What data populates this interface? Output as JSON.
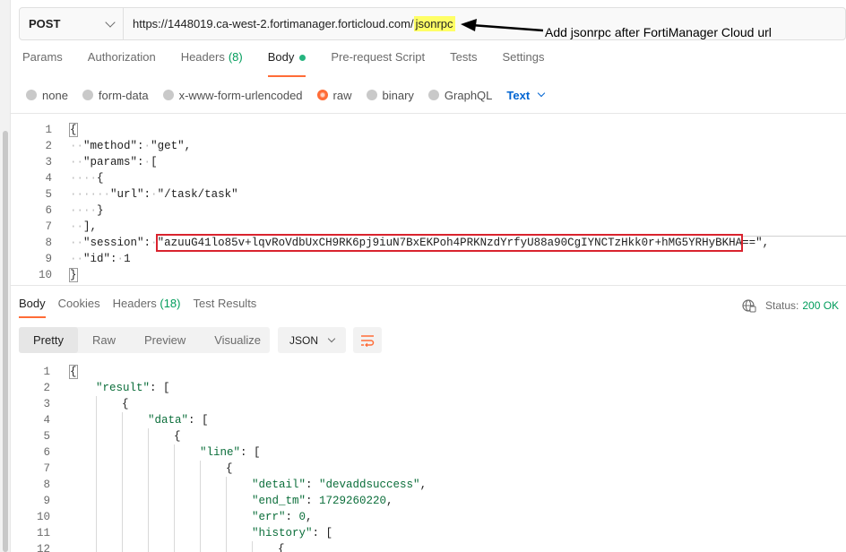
{
  "request": {
    "method": "POST",
    "url_prefix": "https://1448019.ca-west-2.fortimanager.forticloud.com/",
    "url_highlight": "jsonrpc"
  },
  "annotation": {
    "text": "Add jsonrpc after FortiManager Cloud url"
  },
  "tabs": [
    {
      "label": "Params"
    },
    {
      "label": "Authorization"
    },
    {
      "label": "Headers",
      "count": "(8)"
    },
    {
      "label": "Body"
    },
    {
      "label": "Pre-request Script"
    },
    {
      "label": "Tests"
    },
    {
      "label": "Settings"
    }
  ],
  "body_types": [
    "none",
    "form-data",
    "x-www-form-urlencoded",
    "raw",
    "binary",
    "GraphQL"
  ],
  "body_format": "Text",
  "request_body": {
    "line_numbers": [
      "1",
      "2",
      "3",
      "4",
      "5",
      "6",
      "7",
      "8",
      "9",
      "10"
    ],
    "l1": "{",
    "l2_key": "\"method\"",
    "l2_val": "\"get\"",
    "l3_key": "\"params\"",
    "l3_val": "[",
    "l4": "{",
    "l5_key": "\"url\"",
    "l5_val": "\"/task/task\"",
    "l6": "}",
    "l7": "],",
    "l8_key": "\"session\"",
    "l8_val": "\"azuuG41lo85v+lqvRoVdbUxCH9RK6pj9iuN7BxEKPoh4PRKNzdYrfyU88a90CgIYNCTzHkk0r+hMG5YRHyBKHA==\",",
    "l9_key": "\"id\"",
    "l9_val": "1",
    "l10": "}"
  },
  "response_tabs": [
    {
      "label": "Body"
    },
    {
      "label": "Cookies"
    },
    {
      "label": "Headers",
      "count": "(18)"
    },
    {
      "label": "Test Results"
    }
  ],
  "status": {
    "label": "Status:",
    "value": "200 OK"
  },
  "view_modes": [
    "Pretty",
    "Raw",
    "Preview",
    "Visualize"
  ],
  "response_format": "JSON",
  "response_body": {
    "line_numbers": [
      "1",
      "2",
      "3",
      "4",
      "5",
      "6",
      "7",
      "8",
      "9",
      "10",
      "11",
      "12"
    ],
    "l1": "{",
    "l2_key": "\"result\"",
    "l2_val": "[",
    "l3": "{",
    "l4_key": "\"data\"",
    "l4_val": "[",
    "l5": "{",
    "l6_key": "\"line\"",
    "l6_val": "[",
    "l7": "{",
    "l8_key": "\"detail\"",
    "l8_val": "\"devaddsuccess\"",
    "l9_key": "\"end_tm\"",
    "l9_val": "1729260220",
    "l10_key": "\"err\"",
    "l10_val": "0",
    "l11_key": "\"history\"",
    "l11_val": "[",
    "l12": "{"
  }
}
